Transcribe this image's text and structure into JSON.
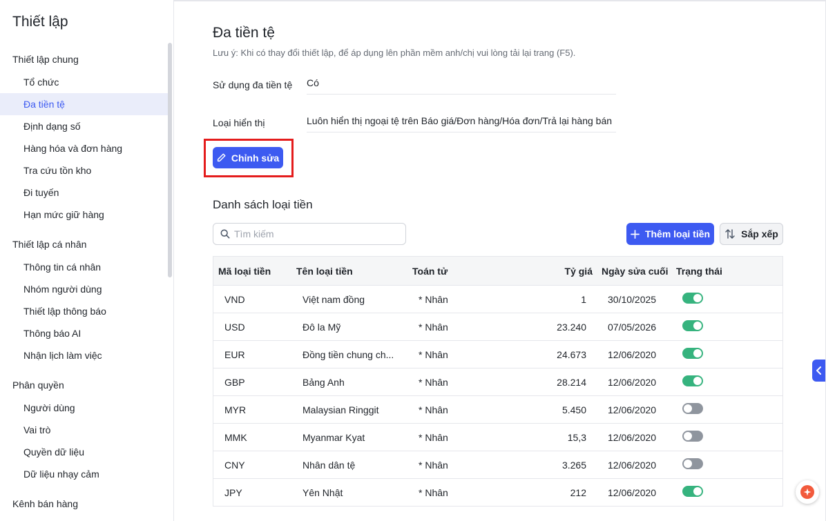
{
  "sidebar": {
    "title": "Thiết lập",
    "groups": [
      {
        "label": "Thiết lập chung",
        "items": [
          "Tổ chức",
          "Đa tiền tệ",
          "Định dạng số",
          "Hàng hóa và đơn hàng",
          "Tra cứu tồn kho",
          "Đi tuyến",
          "Hạn mức giữ hàng"
        ]
      },
      {
        "label": "Thiết lập cá nhân",
        "items": [
          "Thông tin cá nhân",
          "Nhóm người dùng",
          "Thiết lập thông báo",
          "Thông báo AI",
          "Nhận lịch làm việc"
        ]
      },
      {
        "label": "Phân quyền",
        "items": [
          "Người dùng",
          "Vai trò",
          "Quyền dữ liệu",
          "Dữ liệu nhạy cảm"
        ]
      },
      {
        "label": "Kênh bán hàng",
        "items": []
      }
    ],
    "active_item": "Đa tiền tệ"
  },
  "main": {
    "title": "Đa tiền tệ",
    "note": "Lưu ý: Khi có thay đổi thiết lập, để áp dụng lên phần mềm anh/chị vui lòng tải lại trang (F5).",
    "fields": [
      {
        "label": "Sử dụng đa tiền tệ",
        "value": "Có"
      },
      {
        "label": "Loại hiển thị",
        "value": "Luôn hiển thị ngoại tệ trên Báo giá/Đơn hàng/Hóa đơn/Trả lại hàng bán"
      }
    ],
    "edit_label": "Chỉnh sửa",
    "list_title": "Danh sách loại tiền",
    "search_placeholder": "Tìm kiếm",
    "add_label": "Thêm loại tiền",
    "sort_label": "Sắp xếp"
  },
  "table": {
    "columns": [
      "Mã loại tiền",
      "Tên loại tiền",
      "Toán tử",
      "Tỷ giá",
      "Ngày sửa cuối",
      "Trạng thái"
    ],
    "rows": [
      {
        "code": "VND",
        "name": "Việt nam đồng",
        "op": "* Nhân",
        "rate": "1",
        "date": "30/10/2025",
        "active": true
      },
      {
        "code": "USD",
        "name": "Đô la Mỹ",
        "op": "* Nhân",
        "rate": "23.240",
        "date": "07/05/2026",
        "active": true
      },
      {
        "code": "EUR",
        "name": "Đồng tiền chung ch...",
        "op": "* Nhân",
        "rate": "24.673",
        "date": "12/06/2020",
        "active": true
      },
      {
        "code": "GBP",
        "name": "Bảng Anh",
        "op": "* Nhân",
        "rate": "28.214",
        "date": "12/06/2020",
        "active": true
      },
      {
        "code": "MYR",
        "name": "Malaysian Ringgit",
        "op": "* Nhân",
        "rate": "5.450",
        "date": "12/06/2020",
        "active": false
      },
      {
        "code": "MMK",
        "name": "Myanmar Kyat",
        "op": "* Nhân",
        "rate": "15,3",
        "date": "12/06/2020",
        "active": false
      },
      {
        "code": "CNY",
        "name": "Nhân dân tệ",
        "op": "* Nhân",
        "rate": "3.265",
        "date": "12/06/2020",
        "active": false
      },
      {
        "code": "JPY",
        "name": "Yên Nhật",
        "op": "* Nhân",
        "rate": "212",
        "date": "12/06/2020",
        "active": true
      }
    ]
  },
  "colors": {
    "accent": "#3d5af1",
    "toggle_on": "#36b37e",
    "toggle_off": "#8f959e",
    "highlight": "#e41c1c"
  }
}
